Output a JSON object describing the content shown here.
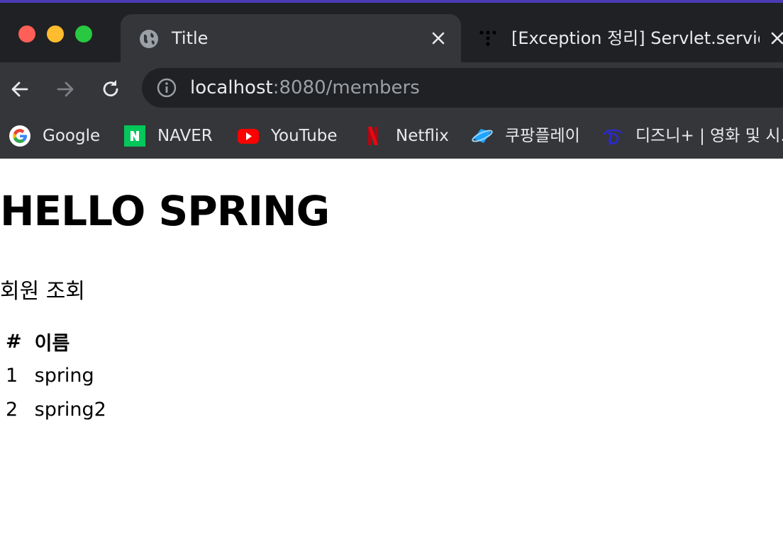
{
  "browser": {
    "active_tab": {
      "title": "Title",
      "favicon": "globe-icon"
    },
    "inactive_tab": {
      "title": "[Exception 정리] Servlet.service",
      "favicon": "dots-icon"
    },
    "url": {
      "host": "localhost",
      "rest": ":8080/members"
    },
    "bookmarks": [
      {
        "label": "Google",
        "icon": "google-icon"
      },
      {
        "label": "NAVER",
        "icon": "naver-icon"
      },
      {
        "label": "YouTube",
        "icon": "youtube-icon"
      },
      {
        "label": "Netflix",
        "icon": "netflix-icon"
      },
      {
        "label": "쿠팡플레이",
        "icon": "coupangplay-icon"
      },
      {
        "label": "디즈니+ | 영화 및 시..",
        "icon": "disney-icon"
      }
    ]
  },
  "page": {
    "heading": "HELLO SPRING",
    "subtitle": "회원 조회",
    "table": {
      "headers": [
        "#",
        "이름"
      ],
      "rows": [
        [
          "1",
          "spring"
        ],
        [
          "2",
          "spring2"
        ]
      ]
    }
  },
  "colors": {
    "chrome_bg": "#202124",
    "tab_active_bg": "#35363a",
    "text_light": "#e8eaed",
    "text_dim": "#9aa0a6",
    "traffic_red": "#fe5f57",
    "traffic_yellow": "#febc2e",
    "traffic_green": "#28c840"
  }
}
